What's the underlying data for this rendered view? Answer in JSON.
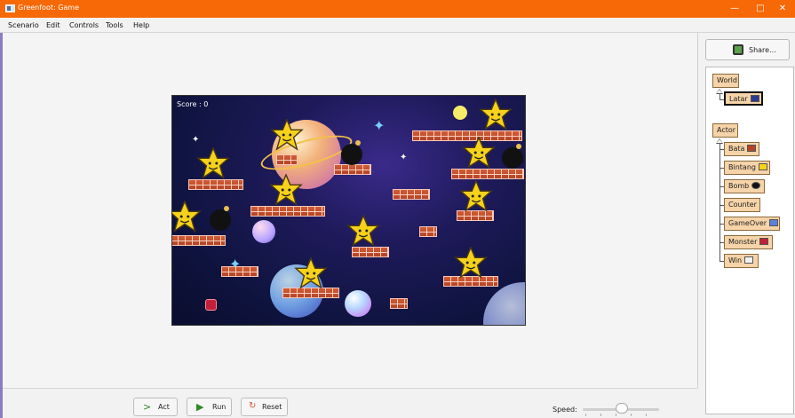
{
  "window": {
    "title": "Greenfoot: Game"
  },
  "menubar": {
    "items": [
      "Scenario",
      "Edit",
      "Controls",
      "Tools",
      "Help"
    ]
  },
  "world": {
    "score_text": "Score : 0"
  },
  "controls": {
    "act_label": "Act",
    "run_label": "Run",
    "reset_label": "Reset",
    "speed_label": "Speed:",
    "speed_level": 0.45
  },
  "share": {
    "label": "Share..."
  },
  "classes": {
    "world_root": "World",
    "world_sub": "Latar",
    "actor_root": "Actor",
    "actors": [
      "Bata",
      "Bintang",
      "Bomb",
      "Counter",
      "GameOver",
      "Monster",
      "Win"
    ]
  },
  "icons": {
    "act": "step-arrow-icon",
    "run": "play-icon",
    "reset": "reset-icon",
    "share": "share-icon",
    "minimize": "minimize-icon",
    "maximize": "maximize-icon",
    "close": "close-icon"
  },
  "colors": {
    "titlebar": "#f76806",
    "class_box": "#f6d3a8",
    "brick": "#c44d2c",
    "star": "#f7d21c"
  }
}
